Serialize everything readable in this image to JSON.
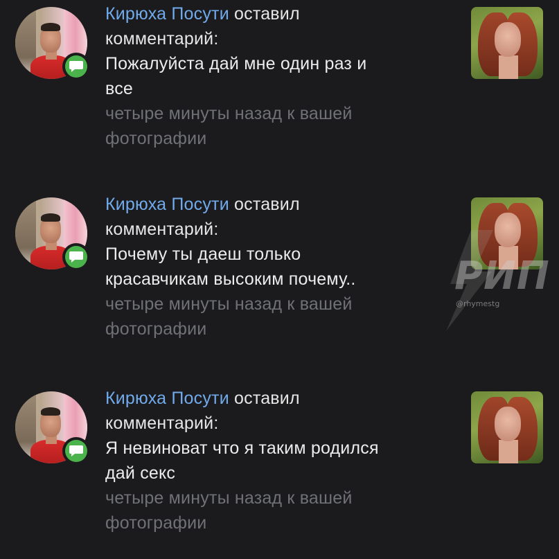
{
  "notifications": [
    {
      "author": "Кирюха Посути",
      "action_line1": "оставил",
      "action_line2": "комментарий:",
      "message_line1": "Пожалуйста дай мне один раз и",
      "message_line2": "все",
      "meta_line1": "четыре минуты назад к вашей",
      "meta_line2": "фотографии"
    },
    {
      "author": "Кирюха Посути",
      "action_line1": "оставил",
      "action_line2": "комментарий:",
      "message_line1": "Почему ты даеш только",
      "message_line2": "красавчикам высоким почему..",
      "meta_line1": "четыре минуты назад к вашей",
      "meta_line2": "фотографии"
    },
    {
      "author": "Кирюха Посути",
      "action_line1": "оставил",
      "action_line2": "комментарий:",
      "message_line1": "Я невиноват что я таким родился",
      "message_line2": "дай секс",
      "meta_line1": "четыре минуты назад к вашей",
      "meta_line2": "фотографии"
    }
  ],
  "watermark": {
    "brand": "РИП",
    "handle": "@rhymestg"
  },
  "icons": {
    "badge": "comment-bubble-icon",
    "watermark_mark": "lightning-bolt-icon"
  },
  "colors": {
    "background": "#1b1b1d",
    "author_link": "#71aaeb",
    "badge_green": "#4bb34b",
    "meta_gray": "#6f7175"
  }
}
